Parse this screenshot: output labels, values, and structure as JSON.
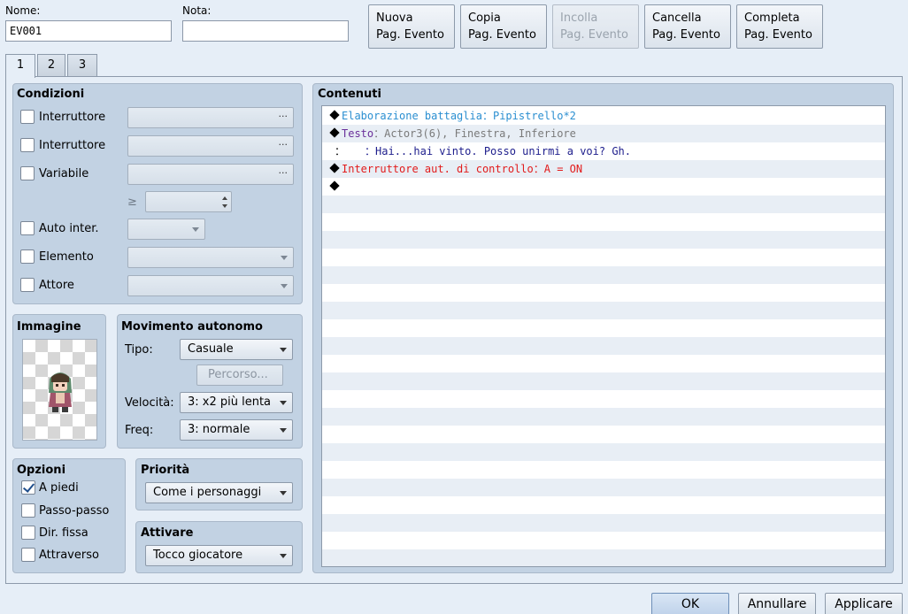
{
  "header": {
    "name_label": "Nome:",
    "name_value": "EV001",
    "note_label": "Nota:",
    "note_value": ""
  },
  "toolbar": {
    "new_page": [
      "Nuova",
      "Pag. Evento"
    ],
    "copy_page": [
      "Copia",
      "Pag. Evento"
    ],
    "paste_page": [
      "Incolla",
      "Pag. Evento"
    ],
    "delete_page": [
      "Cancella",
      "Pag. Evento"
    ],
    "clear_page": [
      "Completa",
      "Pag. Evento"
    ]
  },
  "tabs": [
    "1",
    "2",
    "3"
  ],
  "conditions": {
    "title": "Condizioni",
    "switch1": "Interruttore",
    "switch2": "Interruttore",
    "variable": "Variabile",
    "gte": "≥",
    "self_switch": "Auto inter.",
    "item": "Elemento",
    "actor": "Attore",
    "dots": "···"
  },
  "image": {
    "title": "Immagine"
  },
  "movement": {
    "title": "Movimento autonomo",
    "type_label": "Tipo:",
    "type_value": "Casuale",
    "route_button": "Percorso...",
    "speed_label": "Velocità:",
    "speed_value": "3: x2 più lenta",
    "freq_label": "Freq:",
    "freq_value": "3: normale"
  },
  "options": {
    "title": "Opzioni",
    "walking": "A piedi",
    "stepping": "Passo-passo",
    "direction_fix": "Dir. fissa",
    "through": "Attraverso",
    "walking_checked": true
  },
  "priority": {
    "title": "Priorità",
    "value": "Come i personaggi"
  },
  "trigger": {
    "title": "Attivare",
    "value": "Tocco giocatore"
  },
  "contents": {
    "title": "Contenuti",
    "lines": [
      {
        "cmd": "Elaborazione battaglia",
        "sep": "：",
        "arg": "Pipistrello*2"
      },
      {
        "cmd": "Testo",
        "sep": "：",
        "arg": "Actor3(6), Finestra, Inferiore"
      },
      {
        "prefix": "：",
        "sep": "：",
        "arg": "Hai...hai vinto. Posso unirmi a voi? Gh."
      },
      {
        "cmd": "Interruttore aut. di controllo",
        "sep": "：",
        "arg": "A = ON"
      }
    ]
  },
  "footer": {
    "ok": "OK",
    "cancel": "Annullare",
    "apply": "Applicare"
  },
  "colors": {
    "accent": "#2b8fd1",
    "switch": "#e21b1b",
    "text_cmd": "#6a2f9a"
  }
}
